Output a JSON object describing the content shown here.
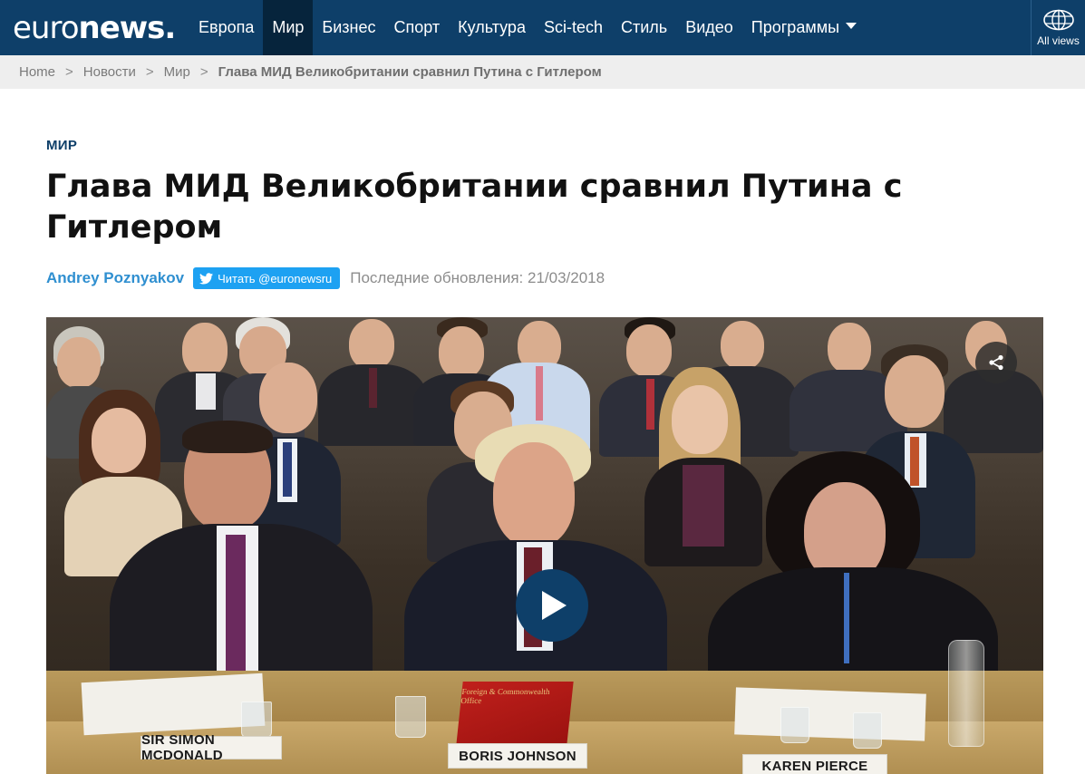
{
  "header": {
    "logo": {
      "text_light": "euro",
      "text_bold": "news",
      "dot": "."
    },
    "nav": [
      {
        "label": "Европа",
        "active": false
      },
      {
        "label": "Мир",
        "active": true
      },
      {
        "label": "Бизнес",
        "active": false
      },
      {
        "label": "Спорт",
        "active": false
      },
      {
        "label": "Культура",
        "active": false
      },
      {
        "label": "Sci-tech",
        "active": false
      },
      {
        "label": "Стиль",
        "active": false
      },
      {
        "label": "Видео",
        "active": false
      },
      {
        "label": "Программы",
        "active": false,
        "has_dropdown": true
      }
    ],
    "all_views": {
      "label": "All views",
      "icon": "globe-icon"
    }
  },
  "breadcrumb": {
    "items": [
      "Home",
      "Новости",
      "Мир"
    ],
    "separator": ">",
    "current": "Глава МИД Великобритании сравнил Путина с Гитлером"
  },
  "article": {
    "section": "МИР",
    "headline": "Глава МИД Великобритании сравнил Путина с Гитлером",
    "author": "Andrey Poznyakov",
    "twitter_button": {
      "label": "Читать @euronewsru",
      "icon": "twitter-bird-icon"
    },
    "updated": "Последние обновления: 21/03/2018"
  },
  "video": {
    "share_icon": "share-icon",
    "play_icon": "play-icon",
    "nameplates": [
      "SIR SIMON MCDONALD",
      "BORIS JOHNSON",
      "KAREN PIERCE"
    ],
    "folder_text": "Foreign & Commonwealth Office"
  },
  "colors": {
    "nav_bg": "#0e3f69",
    "nav_active_bg": "#06243c",
    "breadcrumb_bg": "#eeeeee",
    "section_label": "#0e3f69",
    "author": "#2f8fd0",
    "twitter": "#1da1f2",
    "play_button": "#0e3f69"
  }
}
